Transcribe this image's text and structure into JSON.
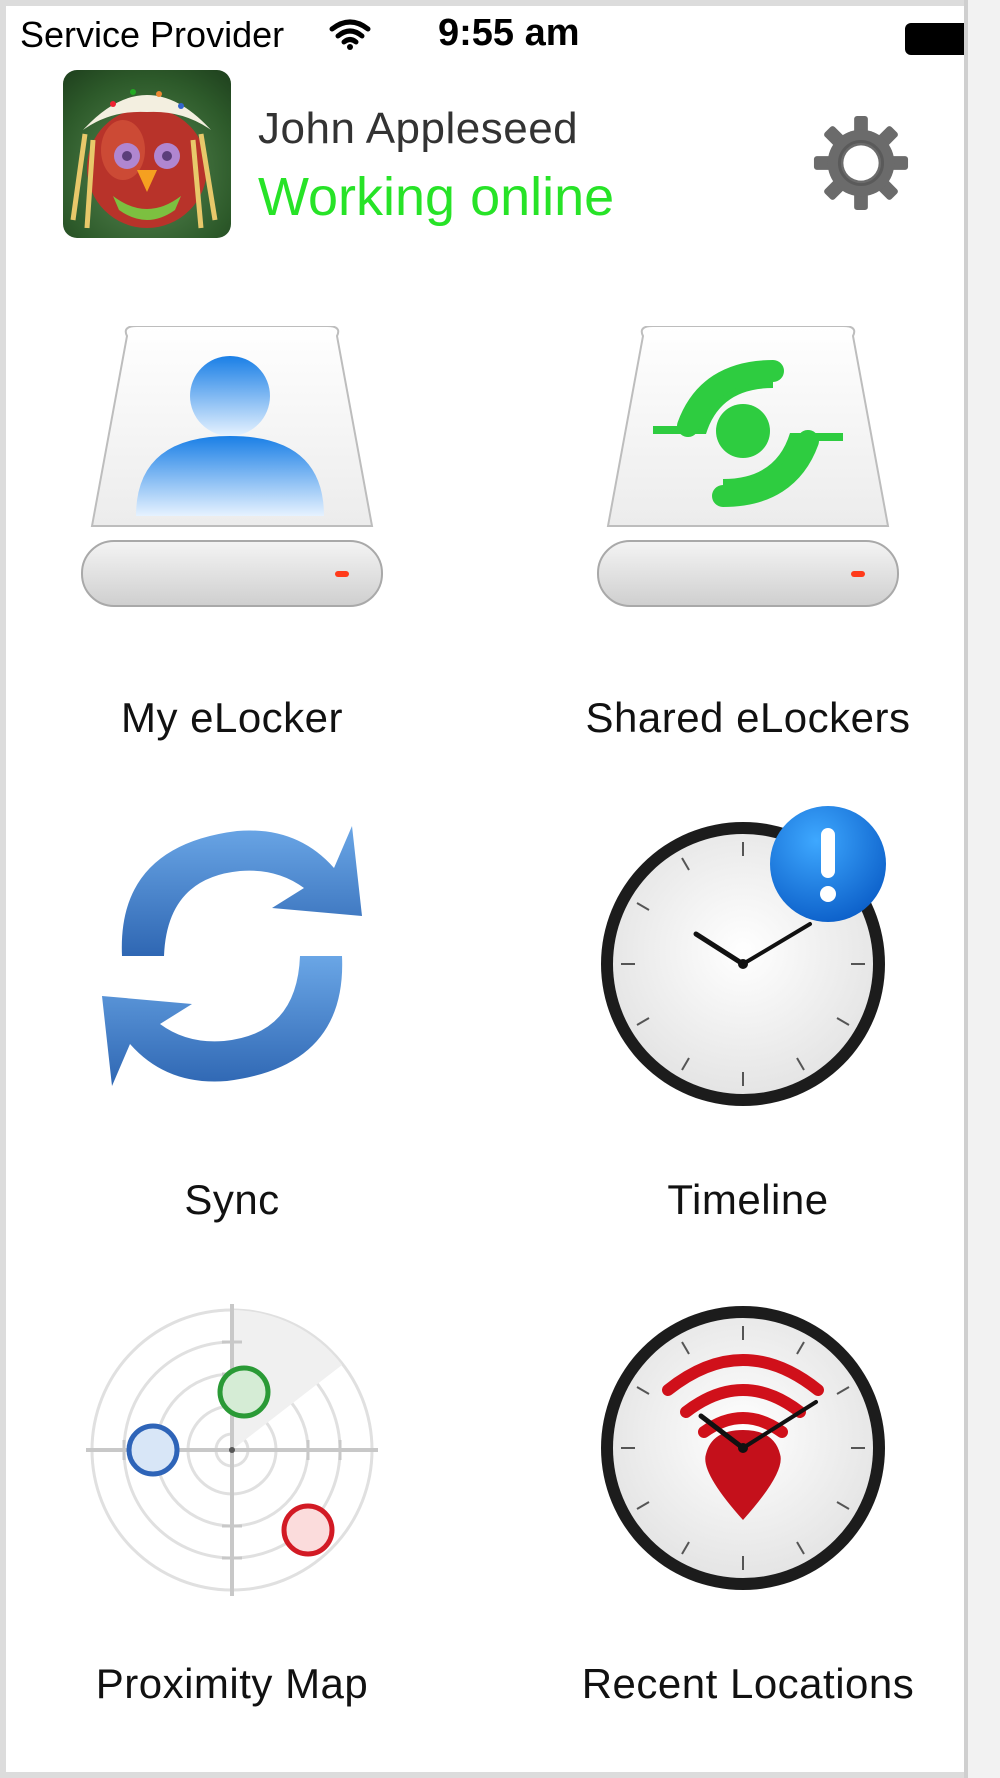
{
  "status_bar": {
    "carrier": "Service Provider",
    "time": "9:55 am"
  },
  "header": {
    "user_name": "John Appleseed",
    "user_status": "Working online",
    "status_color": "#27e327"
  },
  "tiles": [
    {
      "label": "My eLocker",
      "icon": "drive-user-icon"
    },
    {
      "label": "Shared eLockers",
      "icon": "drive-shared-icon"
    },
    {
      "label": "Sync",
      "icon": "sync-icon"
    },
    {
      "label": "Timeline",
      "icon": "clock-alert-icon"
    },
    {
      "label": "Proximity Map",
      "icon": "radar-icon"
    },
    {
      "label": "Recent Locations",
      "icon": "clock-location-icon"
    }
  ],
  "colors": {
    "accent_blue": "#3f7fd0",
    "shared_green": "#2ecc40",
    "location_red": "#d0101a"
  }
}
